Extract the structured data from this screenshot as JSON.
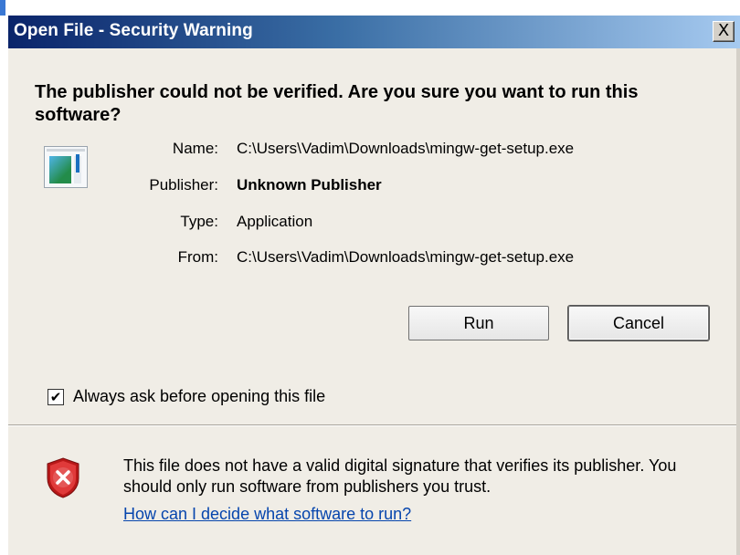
{
  "window": {
    "title": "Open File - Security Warning",
    "close_label": "X"
  },
  "headline": "The publisher could not be verified.  Are you sure you want to run this software?",
  "details": [
    {
      "label": "Name:",
      "value": "C:\\Users\\Vadim\\Downloads\\mingw-get-setup.exe"
    },
    {
      "label": "Publisher:",
      "value": "Unknown Publisher"
    },
    {
      "label": "Type:",
      "value": "Application"
    },
    {
      "label": "From:",
      "value": "C:\\Users\\Vadim\\Downloads\\mingw-get-setup.exe"
    }
  ],
  "buttons": {
    "run": "Run",
    "cancel": "Cancel"
  },
  "always_ask": {
    "checked": true,
    "label": "Always ask before opening this file"
  },
  "warning": {
    "message": "This file does not have a valid digital signature that verifies its publisher.  You should only run software from publishers you trust.",
    "link": "How can I decide what software to run?"
  },
  "colors": {
    "title_bar_start": "#0a246a",
    "title_bar_end": "#a6caf0",
    "dialog_background": "#f0ede6",
    "link": "#0645ad",
    "shield_red": "#d42020"
  },
  "icons": {
    "file": "application-file-icon",
    "shield": "security-shield-error-icon",
    "close": "close-icon"
  }
}
